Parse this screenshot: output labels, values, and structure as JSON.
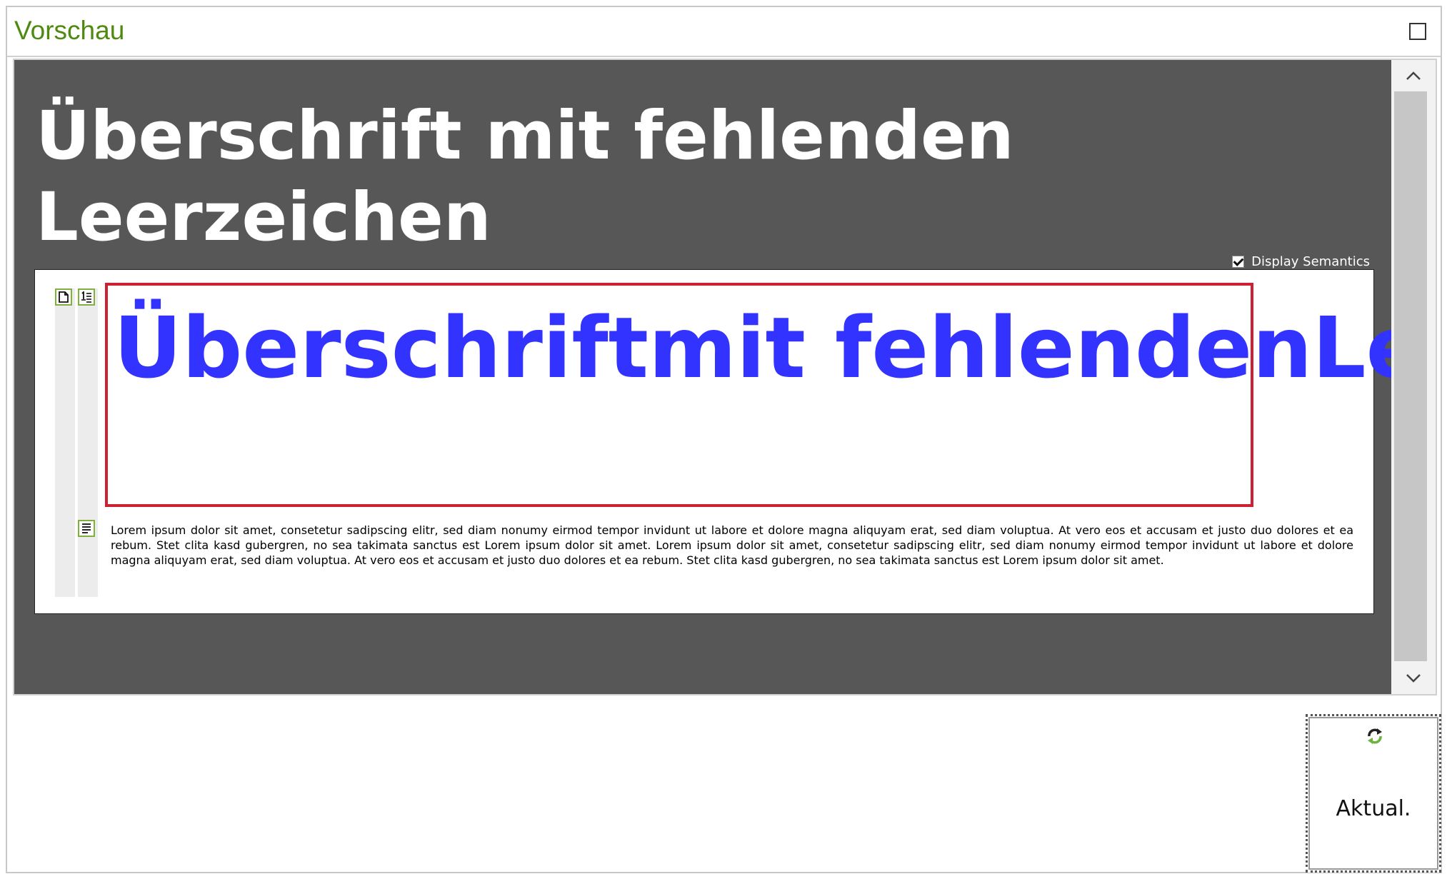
{
  "panel": {
    "title": "Vorschau",
    "maximize_icon": "maximize-icon"
  },
  "preview": {
    "heading": "Überschrift mit fehlenden Leerzeichen",
    "display_semantics_label": "Display Semantics",
    "display_semantics_checked": true,
    "semantic_heading": "Überschriftmit fehlendenLeerzeichen",
    "paragraph": "Lorem ipsum dolor sit amet, consetetur sadipscing elitr, sed diam nonumy eirmod tempor invidunt ut labore et dolore magna aliquyam erat, sed diam voluptua. At vero eos et accusam et justo duo dolores et ea rebum. Stet clita kasd gubergren, no sea takimata sanctus est Lorem ipsum dolor sit amet. Lorem ipsum dolor sit amet, consetetur sadipscing elitr, sed diam nonumy eirmod tempor invidunt ut labore et dolore magna aliquyam erat, sed diam voluptua. At vero eos et accusam et justo duo dolores et ea rebum. Stet clita kasd gubergren, no sea takimata sanctus est Lorem ipsum dolor sit amet.",
    "icons": [
      "document-icon",
      "heading-icon",
      "paragraph-icon"
    ],
    "highlight_color": "#cc2033",
    "heading_color": "#3333ff",
    "canvas_color": "#575757"
  },
  "refresh": {
    "label": "Aktual.",
    "icon": "refresh-icon"
  },
  "accent_color": "#4f8a10"
}
